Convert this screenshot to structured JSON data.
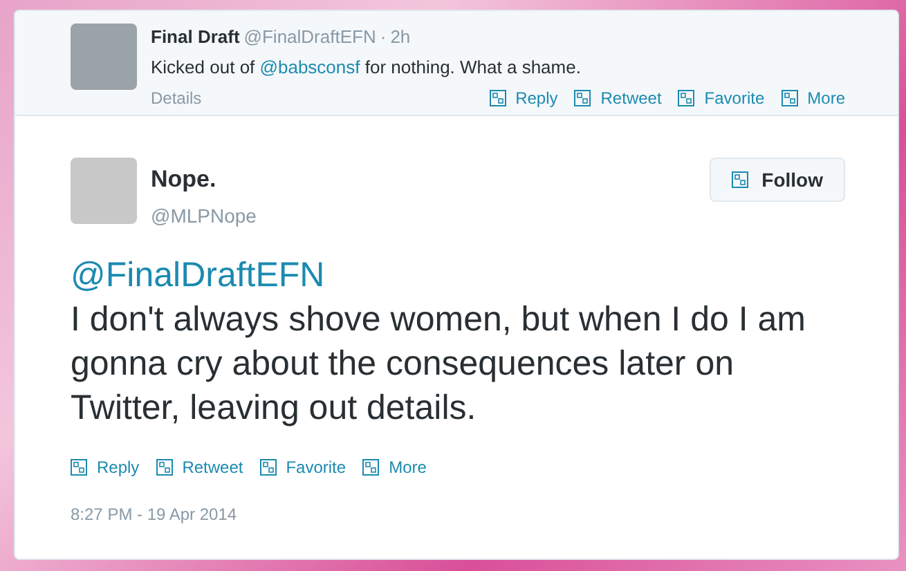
{
  "parent_tweet": {
    "name": "Final Draft",
    "handle": "@FinalDraftEFN",
    "separator": "·",
    "time": "2h",
    "text_before": "Kicked out of",
    "mention": "@babsconsf",
    "text_after": "for nothing. What a shame.",
    "details": "Details",
    "actions": [
      "Reply",
      "Retweet",
      "Favorite",
      "More"
    ]
  },
  "tweet": {
    "name": "Nope.",
    "handle": "@MLPNope",
    "follow": "Follow",
    "mention": "@FinalDraftEFN",
    "text": "I don't always shove women, but when I do I am gonna cry about the consequences later on Twitter, leaving out details.",
    "actions": [
      "Reply",
      "Retweet",
      "Favorite",
      "More"
    ],
    "timestamp": "8:27 PM - 19 Apr 2014"
  }
}
